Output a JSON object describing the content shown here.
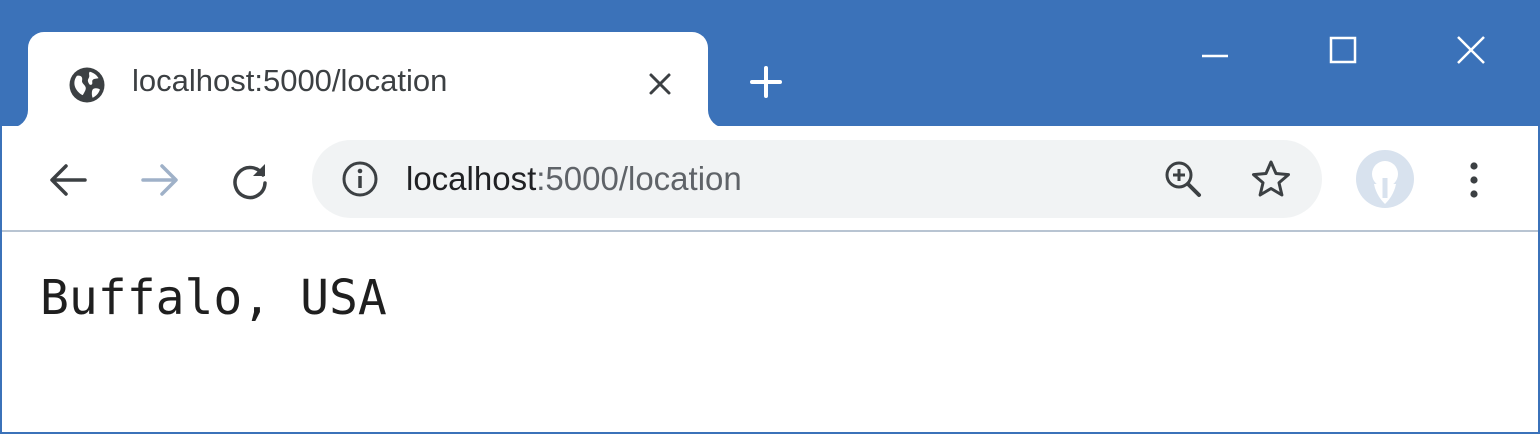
{
  "tab": {
    "title": "localhost:5000/location"
  },
  "address_bar": {
    "url_host": "localhost",
    "url_rest": ":5000/location"
  },
  "page": {
    "text": "Buffalo, USA"
  },
  "icons": {
    "favicon": "globe-icon",
    "tab_close": "close-icon",
    "new_tab": "plus-icon",
    "minimize": "minimize-icon",
    "maximize": "maximize-icon",
    "close_window": "close-icon",
    "back": "arrow-left-icon",
    "forward": "arrow-right-icon",
    "reload": "reload-icon",
    "site_info": "info-icon",
    "zoom": "zoom-in-icon",
    "bookmark": "star-icon",
    "profile": "avatar-icon",
    "menu": "kebab-menu-icon"
  },
  "colors": {
    "titlebar": "#3b72b9",
    "omnibox_bg": "#f1f3f4",
    "forward_disabled": "#9fb1c8"
  }
}
